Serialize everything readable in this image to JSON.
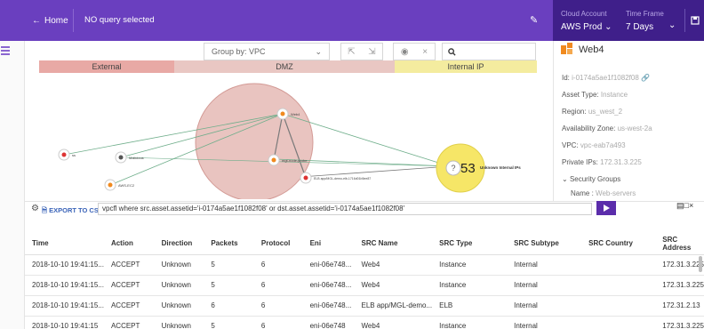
{
  "header": {
    "home_label": "Home",
    "query_status": "NO query selected",
    "cloud_account_title": "Cloud Account",
    "cloud_account_value": "AWS Prod",
    "time_frame_title": "Time Frame",
    "time_frame_value": "7 Days"
  },
  "toolbar": {
    "group_by": "Group by: VPC",
    "search_placeholder": ""
  },
  "zones": {
    "external": "External",
    "dmz": "DMZ",
    "internal": "Internal IP"
  },
  "graph": {
    "cluster_count": "53",
    "cluster_label": "Unknown Internal IPs",
    "nodes": [
      "ss",
      "Malicious",
      "AWS-EC2",
      "Web4",
      "mgt-node-probe",
      "ELB app/MGL-demo-elb-1716d01b5ee87"
    ]
  },
  "side_panel": {
    "title": "Web4",
    "id_label": "Id:",
    "id_value": "i-0174a5ae1f1082f08",
    "asset_type_label": "Asset Type:",
    "asset_type_value": "Instance",
    "region_label": "Region:",
    "region_value": "us_west_2",
    "az_label": "Availability Zone:",
    "az_value": "us-west-2a",
    "vpc_label": "VPC:",
    "vpc_value": "vpc-eab7a493",
    "private_ips_label": "Private IPs:",
    "private_ips_value": "172.31.3.225",
    "security_groups_label": "Security Groups",
    "sg_name_label": "Name :",
    "sg_name_value": "Web-servers"
  },
  "query_bar": {
    "export_label": "EXPORT TO CSV",
    "query": "vpcfl where src.asset.assetid='i-0174a5ae1f1082f08' or dst.asset.assetid='i-0174a5ae1f1082f08'"
  },
  "table": {
    "columns": [
      "Time",
      "Action",
      "Direction",
      "Packets",
      "Protocol",
      "Eni",
      "SRC Name",
      "SRC Type",
      "SRC Subtype",
      "SRC Country",
      "SRC Address"
    ],
    "rows": [
      [
        "2018-10-10 19:41:15...",
        "ACCEPT",
        "Unknown",
        "5",
        "6",
        "eni-06e748...",
        "Web4",
        "Instance",
        "Internal",
        "",
        "172.31.3.225"
      ],
      [
        "2018-10-10 19:41:15...",
        "ACCEPT",
        "Unknown",
        "5",
        "6",
        "eni-06e748...",
        "Web4",
        "Instance",
        "Internal",
        "",
        "172.31.3.225"
      ],
      [
        "2018-10-10 19:41:15...",
        "ACCEPT",
        "Unknown",
        "6",
        "6",
        "eni-06e748...",
        "ELB app/MGL-demo...",
        "ELB",
        "Internal",
        "",
        "172.31.2.13"
      ],
      [
        "2018-10-10 19:41:15",
        "ACCEPT",
        "Unknown",
        "5",
        "6",
        "eni-06e748",
        "Web4",
        "Instance",
        "Internal",
        "",
        "172.31.3.225"
      ]
    ]
  },
  "colors": {
    "brand": "#6a3fbf",
    "brand_dark": "#3f1f8a",
    "external_zone": "#e8a9a5",
    "dmz_zone": "#e9c7c3",
    "internal_zone": "#f4ec9f"
  }
}
